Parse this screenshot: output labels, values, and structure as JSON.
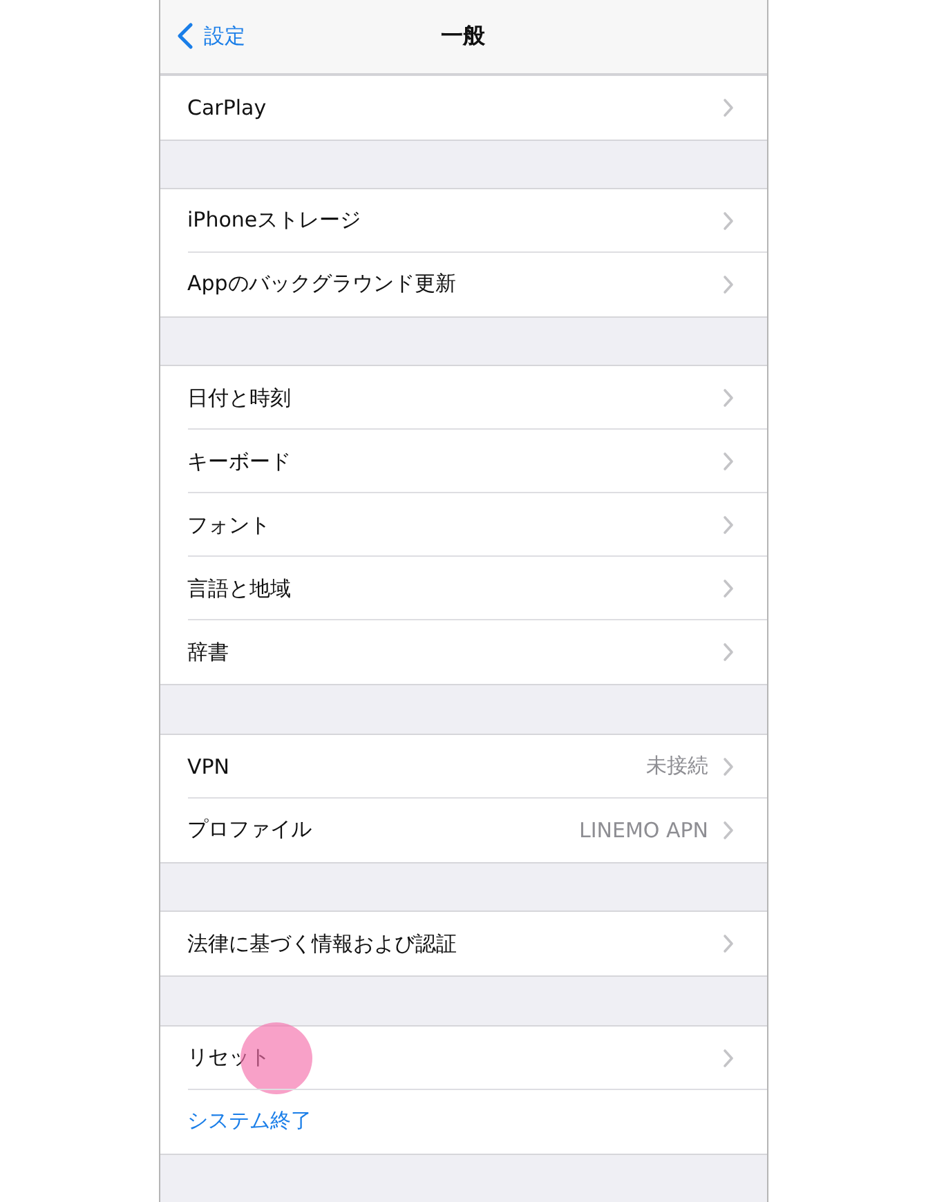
{
  "nav": {
    "back_label": "設定",
    "title": "一般"
  },
  "groups": [
    {
      "rows": [
        {
          "kind": "link",
          "label": "CarPlay",
          "touched": false
        }
      ]
    },
    {
      "rows": [
        {
          "kind": "link",
          "label": "iPhoneストレージ",
          "touched": false
        },
        {
          "kind": "link",
          "label": "Appのバックグラウンド更新",
          "touched": false
        }
      ]
    },
    {
      "rows": [
        {
          "kind": "link",
          "label": "日付と時刻",
          "touched": false
        },
        {
          "kind": "link",
          "label": "キーボード",
          "touched": false
        },
        {
          "kind": "link",
          "label": "フォント",
          "touched": false
        },
        {
          "kind": "link",
          "label": "言語と地域",
          "touched": false
        },
        {
          "kind": "link",
          "label": "辞書",
          "touched": false
        }
      ]
    },
    {
      "rows": [
        {
          "kind": "link",
          "label": "VPN",
          "value": "未接続",
          "touched": false
        },
        {
          "kind": "link",
          "label": "プロファイル",
          "value": "LINEMO APN",
          "touched": false
        }
      ]
    },
    {
      "rows": [
        {
          "kind": "link",
          "label": "法律に基づく情報および認証",
          "touched": false
        }
      ]
    },
    {
      "rows": [
        {
          "kind": "link",
          "label": "リセット",
          "touched": true
        },
        {
          "kind": "action",
          "label": "システム終了",
          "touched": false
        }
      ]
    }
  ]
}
